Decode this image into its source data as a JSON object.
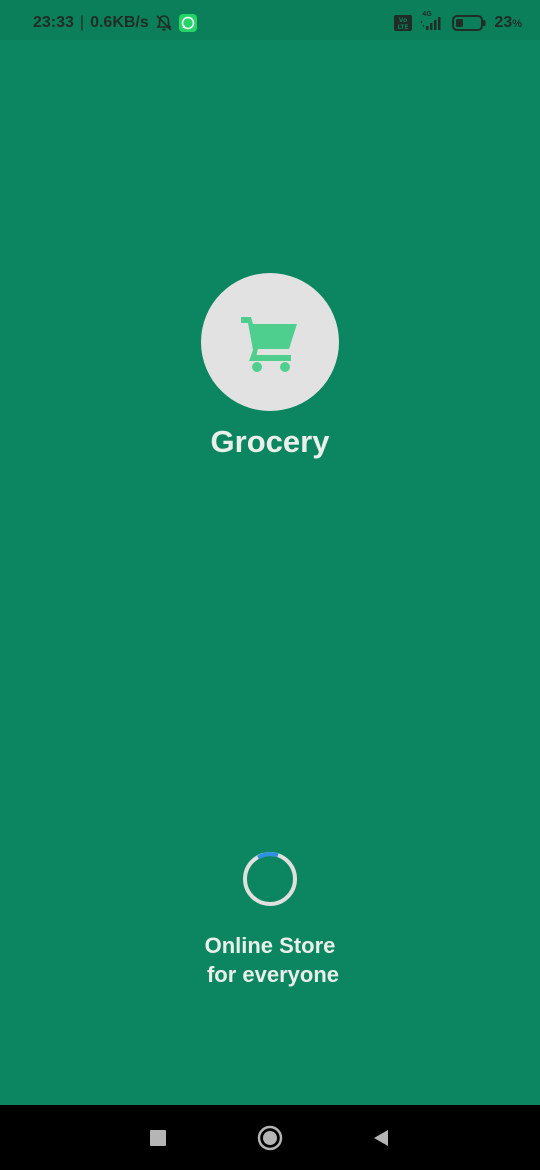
{
  "status_bar": {
    "time": "23:33",
    "separator": "|",
    "speed": "0.6KB/s",
    "network": "4G",
    "battery_percent": "23",
    "battery_suffix": "%",
    "icons": [
      "bell-off-icon",
      "whatsapp-icon",
      "volte-icon",
      "signal-icon",
      "battery-icon"
    ]
  },
  "app": {
    "title": "Grocery",
    "logo_icon": "shopping-cart-icon",
    "tagline_line1": "Online Store",
    "tagline_line2": "for everyone"
  },
  "loading": {
    "indicator": "spinner"
  },
  "navigation_bar": {
    "icons": [
      "recent-apps-icon",
      "home-icon",
      "back-icon"
    ]
  },
  "colors": {
    "background": "#0c8660",
    "status_bar": "#0b7f59",
    "logo_circle": "#e2e2e2",
    "cart": "#4fcf8e",
    "text": "#e9efea",
    "spinner_track": "#e0e0e0",
    "spinner_accent": "#2f8fe0"
  }
}
